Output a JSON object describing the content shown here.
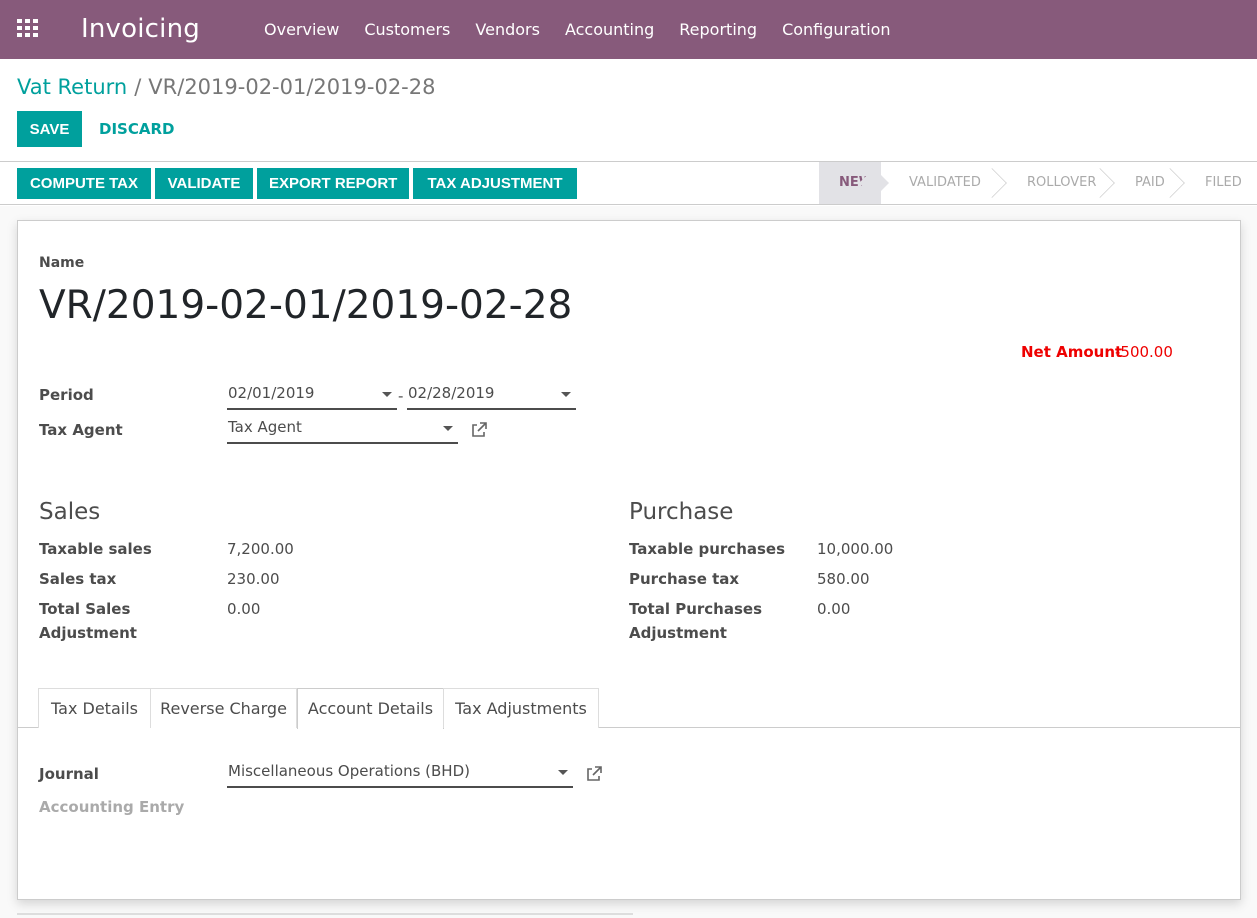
{
  "app": {
    "name": "Invoicing"
  },
  "menu": [
    "Overview",
    "Customers",
    "Vendors",
    "Accounting",
    "Reporting",
    "Configuration"
  ],
  "breadcrumb": {
    "parent": "Vat Return",
    "separator": "/",
    "current": "VR/2019-02-01/2019-02-28"
  },
  "buttons": {
    "save": "SAVE",
    "discard": "DISCARD"
  },
  "actions": [
    "COMPUTE TAX",
    "VALIDATE",
    "EXPORT REPORT",
    "TAX ADJUSTMENT"
  ],
  "stages": [
    "NEW",
    "VALIDATED",
    "ROLLOVER",
    "PAID",
    "FILED"
  ],
  "form": {
    "name_label": "Name",
    "name": "VR/2019-02-01/2019-02-28",
    "net_amount_label": "Net Amount",
    "net_amount": "-500.00",
    "period_label": "Period",
    "period_from": "02/01/2019",
    "period_sep": "-",
    "period_to": "02/28/2019",
    "tax_agent_label": "Tax Agent",
    "tax_agent": "Tax Agent"
  },
  "sales": {
    "title": "Sales",
    "taxable_label": "Taxable sales",
    "taxable": "7,200.00",
    "tax_label": "Sales tax",
    "tax": "230.00",
    "adj_label_1": "Total Sales",
    "adj_label_2": "Adjustment",
    "adj": "0.00"
  },
  "purchase": {
    "title": "Purchase",
    "taxable_label": "Taxable purchases",
    "taxable": "10,000.00",
    "tax_label": "Purchase tax",
    "tax": "580.00",
    "adj_label_1": "Total Purchases",
    "adj_label_2": "Adjustment",
    "adj": "0.00"
  },
  "tabs": [
    "Tax Details",
    "Reverse Charge",
    "Account Details",
    "Tax Adjustments"
  ],
  "account": {
    "journal_label": "Journal",
    "journal": "Miscellaneous Operations (BHD)",
    "entry_label": "Accounting Entry"
  }
}
